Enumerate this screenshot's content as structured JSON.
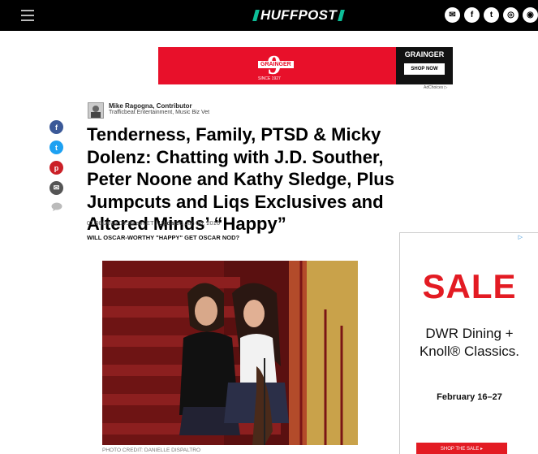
{
  "header": {
    "logo_text": "HUFFPOST",
    "menu_icon": "hamburger-icon",
    "social_icons": [
      "email-icon",
      "facebook-icon",
      "twitter-icon",
      "instagram-icon",
      "snapchat-icon"
    ],
    "social_glyphs": [
      "✉",
      "f",
      "t",
      "◎",
      "◉"
    ],
    "accent_color": "#0dbe98"
  },
  "top_ad": {
    "number": "9",
    "badge": "GRAINGER",
    "since": "SINCE 1927",
    "brand": "GRAINGER",
    "button": "SHOP NOW",
    "color": "#e8102a"
  },
  "adchoices": "AdChoices ▷",
  "author": {
    "name": "Mike Ragogna, Contributor",
    "bio": "Trafficbeat Entertainment, Music Biz Vet"
  },
  "share": [
    {
      "icon": "facebook-icon",
      "glyph": "f",
      "color": "#3b5998"
    },
    {
      "icon": "twitter-icon",
      "glyph": "t",
      "color": "#1da1f2"
    },
    {
      "icon": "pinterest-icon",
      "glyph": "p",
      "color": "#cb2027"
    },
    {
      "icon": "email-icon",
      "glyph": "✉",
      "color": "#555555"
    },
    {
      "icon": "comment-icon",
      "glyph": "",
      "color": "#aaaaaa"
    }
  ],
  "article": {
    "headline": "Tenderness, Family, PTSD & Micky Dolenz: Chatting with J.D. Souther, Peter Noone and Kathy Sledge, Plus Jumpcuts and Liqs Exclusives and Altered Minds’ “Happy”",
    "date": "01/08/2016 09:25 am ET | ",
    "updated_label": "Updated",
    "updated_date": " Jan 08, 2016",
    "subhead": "WILL OSCAR-WORTHY \"HAPPY\" GET OSCAR NOD?",
    "photo_credit": "PHOTO CREDIT: DANIELLE DISPALTRO"
  },
  "side_ad": {
    "sale": "SALE",
    "line1": "DWR Dining +",
    "line2": "Knoll® Classics.",
    "dates": "February 16–27",
    "cta": "SHOP THE SALE ▸",
    "adchoices": "▷"
  }
}
